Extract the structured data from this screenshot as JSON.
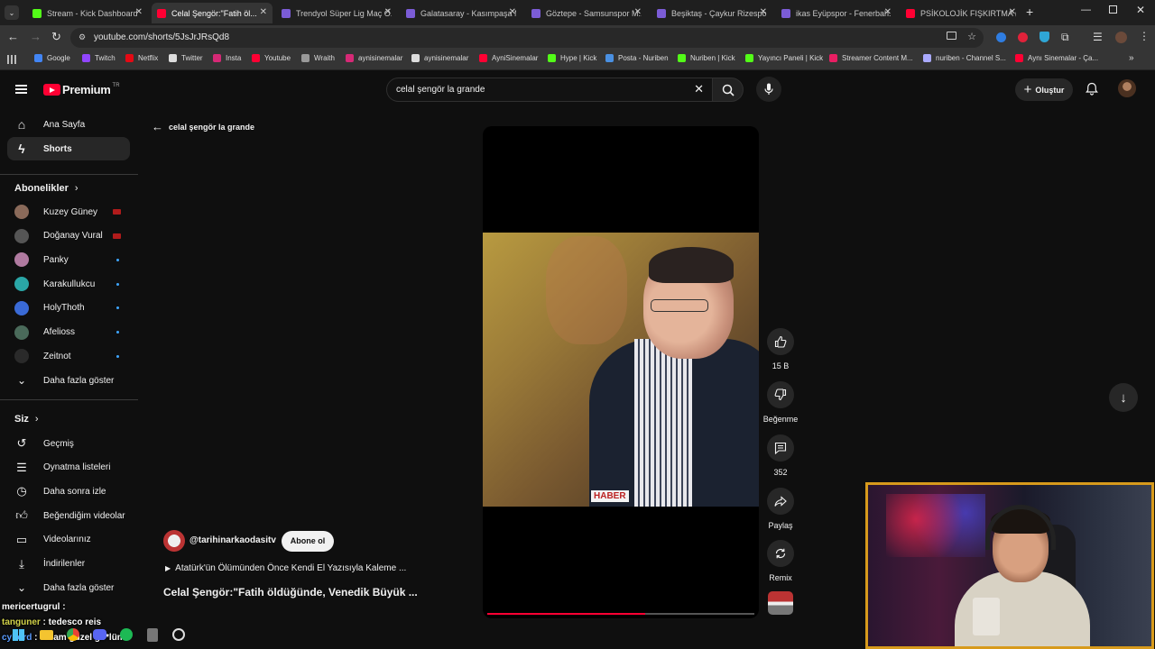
{
  "browser": {
    "tabs": [
      {
        "title": "Stream - Kick Dashboard",
        "color": "#53fc18"
      },
      {
        "title": "Celal Şengör:\"Fatih öl...",
        "color": "#ff0033",
        "active": true
      },
      {
        "title": "Trendyol Süper Lig Maç Ö...",
        "color": "#7b5cd6"
      },
      {
        "title": "Galatasaray - Kasımpaşa M...",
        "color": "#7b5cd6"
      },
      {
        "title": "Göztepe - Samsunspor M...",
        "color": "#7b5cd6"
      },
      {
        "title": "Beşiktaş - Çaykur Rizespo...",
        "color": "#7b5cd6"
      },
      {
        "title": "ikas Eyüpspor - Fenerbah...",
        "color": "#7b5cd6"
      },
      {
        "title": "PSİKOLOJİK FIŞKIRTMA (C...",
        "color": "#ff0033"
      }
    ],
    "url": "youtube.com/shorts/5JsJrJRsQd8",
    "bookmarks": [
      {
        "label": "Google",
        "color": "#4285f4"
      },
      {
        "label": "Twitch",
        "color": "#9146ff"
      },
      {
        "label": "Netflix",
        "color": "#e50914"
      },
      {
        "label": "Twitter",
        "color": "#dddddd"
      },
      {
        "label": "Insta",
        "color": "#d62976"
      },
      {
        "label": "Youtube",
        "color": "#ff0033"
      },
      {
        "label": "Wraith",
        "color": "#999999"
      },
      {
        "label": "aynisinemalar",
        "color": "#d62976"
      },
      {
        "label": "aynisinemalar",
        "color": "#dddddd"
      },
      {
        "label": "AyniSinemalar",
        "color": "#ff0033"
      },
      {
        "label": "Hype | Kick",
        "color": "#53fc18"
      },
      {
        "label": "Posta - Nuriben",
        "color": "#4a90e2"
      },
      {
        "label": "Nuriben | Kick",
        "color": "#53fc18"
      },
      {
        "label": "Yayıncı Paneli | Kick",
        "color": "#53fc18"
      },
      {
        "label": "Streamer Content M...",
        "color": "#e91e63"
      },
      {
        "label": "nuriben - Channel S...",
        "color": "#aaaaff"
      },
      {
        "label": "Aynı Sinemalar - Ça...",
        "color": "#ff0033"
      }
    ]
  },
  "youtube": {
    "logo_text": "Premium",
    "logo_region": "TR",
    "search_value": "celal şengör la grande",
    "create_label": "Oluştur",
    "back_query": "celal şengör la grande",
    "sidebar_top": [
      {
        "label": "Ana Sayfa",
        "icon": "home-icon"
      },
      {
        "label": "Shorts",
        "icon": "shorts-icon",
        "active": true
      }
    ],
    "subscriptions_header": "Abonelikler",
    "subscriptions": [
      {
        "label": "Kuzey Güney",
        "badge": "live",
        "avatar": "#8a6a5a"
      },
      {
        "label": "Doğanay Vural",
        "badge": "live",
        "avatar": "#555555"
      },
      {
        "label": "Panky",
        "badge": "dot",
        "avatar": "#b07aa0"
      },
      {
        "label": "Karakullukcu",
        "badge": "dot",
        "avatar": "#2aa6a6"
      },
      {
        "label": "HolyThoth",
        "badge": "dot",
        "avatar": "#3a6ad6"
      },
      {
        "label": "Afelioss",
        "badge": "dot",
        "avatar": "#4a6a5a"
      },
      {
        "label": "Zeitnot",
        "badge": "dot",
        "avatar": "#2a2a2a"
      }
    ],
    "show_more_1": "Daha fazla göster",
    "you_header": "Siz",
    "you_items": [
      {
        "label": "Geçmiş",
        "icon": "history-icon"
      },
      {
        "label": "Oynatma listeleri",
        "icon": "playlists-icon"
      },
      {
        "label": "Daha sonra izle",
        "icon": "clock-icon"
      },
      {
        "label": "Beğendiğim videolar",
        "icon": "like-icon"
      },
      {
        "label": "Videolarınız",
        "icon": "video-icon"
      },
      {
        "label": "İndirilenler",
        "icon": "download-icon"
      }
    ],
    "show_more_2": "Daha fazla göster",
    "short": {
      "channel": "@tarihinarkaodasitv",
      "subscribe": "Abone ol",
      "playlist_text": "Atatürk'ün Ölümünden Önce Kendi El Yazısıyla Kaleme ...",
      "title": "Celal Şengör:\"Fatih öldüğünde, Venedik Büyük ...",
      "caption_logo": "HABER",
      "progress": 0.59
    },
    "actions": {
      "like_count": "15 B",
      "dislike_label": "Beğenme",
      "comment_count": "352",
      "share_label": "Paylaş",
      "remix_label": "Remix"
    }
  },
  "chat": [
    {
      "user": "mericertugrul",
      "text": "",
      "color": "#ffffff"
    },
    {
      "user": "tanguner",
      "text": "tedesco reis",
      "color": "#d4d44a"
    },
    {
      "user": "cyhord",
      "text": "Selam güzel gö*lüm",
      "color": "#5a9cff"
    }
  ]
}
